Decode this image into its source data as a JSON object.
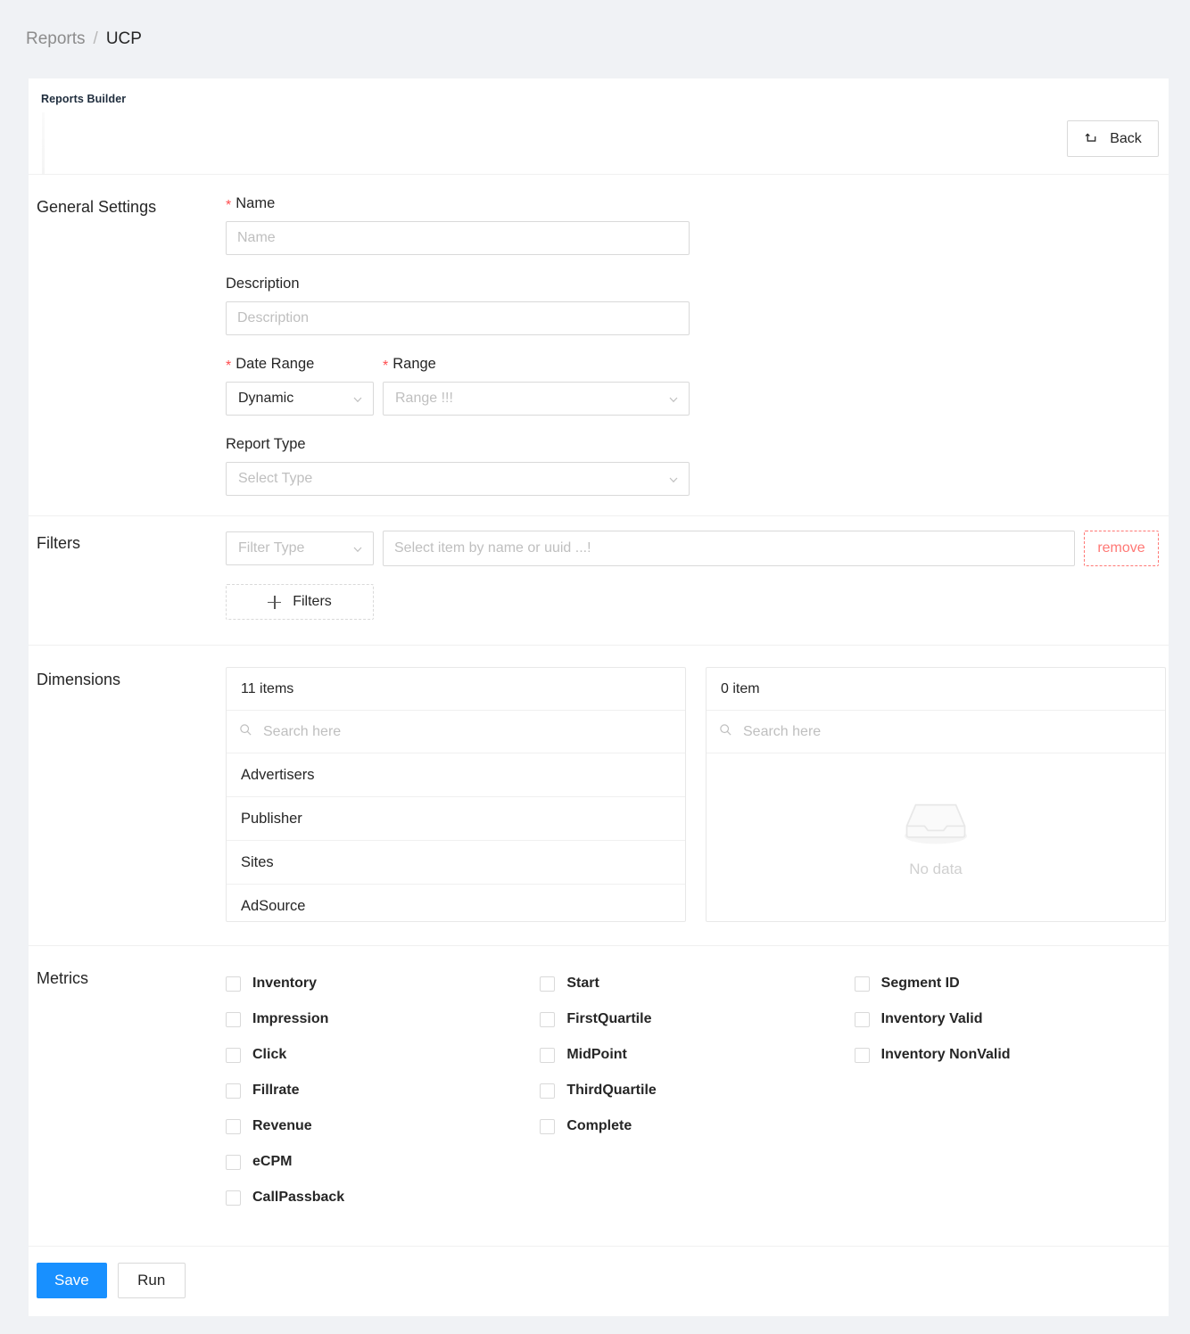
{
  "breadcrumb": {
    "root": "Reports",
    "separator": "/",
    "current": "UCP"
  },
  "card": {
    "title": "Reports Builder",
    "back_label": "Back",
    "back_icon": "undo-arrow-icon"
  },
  "general_settings": {
    "section_label": "General Settings",
    "name": {
      "label": "Name",
      "required_marker": "*",
      "placeholder": "Name",
      "value": ""
    },
    "description": {
      "label": "Description",
      "placeholder": "Description",
      "value": ""
    },
    "date_range": {
      "label": "Date Range",
      "required_marker": "*",
      "value": "Dynamic",
      "chevron_icon": "chevron-down-icon"
    },
    "range": {
      "label": "Range",
      "required_marker": "*",
      "placeholder": "Range !!!",
      "value": "",
      "chevron_icon": "chevron-down-icon"
    },
    "report_type": {
      "label": "Report Type",
      "placeholder": "Select Type",
      "value": "",
      "chevron_icon": "chevron-down-icon"
    }
  },
  "filters": {
    "section_label": "Filters",
    "filter_type_placeholder": "Filter Type",
    "filter_item_placeholder": "Select item by name or uuid ...!",
    "remove_label": "remove",
    "add_label": "Filters",
    "add_icon": "plus-icon"
  },
  "dimensions": {
    "section_label": "Dimensions",
    "available": {
      "count_label": "11 items",
      "search_placeholder": "Search here",
      "search_icon": "search-icon",
      "items": [
        "Advertisers",
        "Publisher",
        "Sites",
        "AdSource"
      ]
    },
    "selected": {
      "count_label": "0 item",
      "search_placeholder": "Search here",
      "search_icon": "search-icon",
      "empty_text": "No data",
      "empty_icon": "empty-box-icon"
    }
  },
  "metrics": {
    "section_label": "Metrics",
    "columns": [
      {
        "items": [
          {
            "label": "Inventory",
            "checked": false
          },
          {
            "label": "Impression",
            "checked": false
          },
          {
            "label": "Click",
            "checked": false
          },
          {
            "label": "Fillrate",
            "checked": false
          },
          {
            "label": "Revenue",
            "checked": false
          },
          {
            "label": "eCPM",
            "checked": false
          },
          {
            "label": "CallPassback",
            "checked": false
          }
        ]
      },
      {
        "items": [
          {
            "label": "Start",
            "checked": false
          },
          {
            "label": "FirstQuartile",
            "checked": false
          },
          {
            "label": "MidPoint",
            "checked": false
          },
          {
            "label": "ThirdQuartile",
            "checked": false
          },
          {
            "label": "Complete",
            "checked": false
          }
        ]
      },
      {
        "items": [
          {
            "label": "Segment ID",
            "checked": false
          },
          {
            "label": "Inventory Valid",
            "checked": false
          },
          {
            "label": "Inventory NonValid",
            "checked": false
          }
        ]
      }
    ]
  },
  "footer": {
    "save_label": "Save",
    "run_label": "Run"
  },
  "colors": {
    "page_background": "#f0f2f5",
    "primary": "#1890ff",
    "required_star": "#ff4d4f",
    "danger": "#ff7875",
    "border": "#d9d9d9",
    "placeholder": "#bfbfbf"
  }
}
